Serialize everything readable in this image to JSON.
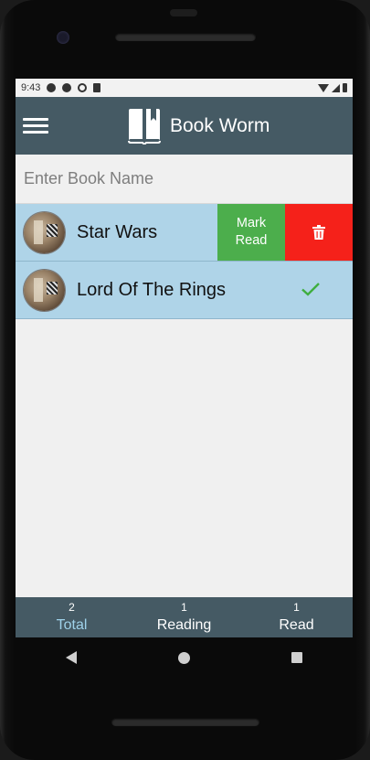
{
  "status_bar": {
    "time": "9:43",
    "icons": [
      "settings-icon",
      "accessibility-icon",
      "sync-icon",
      "sd-card-icon",
      "wifi-icon",
      "signal-icon",
      "battery-icon"
    ]
  },
  "header": {
    "title": "Book Worm",
    "color": "#455a64"
  },
  "search": {
    "placeholder": "Enter Book Name",
    "value": ""
  },
  "books": [
    {
      "title": "Star Wars",
      "actions": {
        "mark_read_label_1": "Mark",
        "mark_read_label_2": "Read",
        "delete_icon": "trash-icon"
      },
      "mark_color": "#4cae4c",
      "delete_color": "#f5211a"
    },
    {
      "title": "Lord Of The Rings",
      "read": true,
      "status_icon": "checkmark-icon"
    }
  ],
  "stats": [
    {
      "count": "2",
      "label": "Total",
      "active": true
    },
    {
      "count": "1",
      "label": "Reading"
    },
    {
      "count": "1",
      "label": "Read"
    }
  ],
  "colors": {
    "row_bg": "#afd4e8",
    "accent": "#9fd2ea"
  }
}
